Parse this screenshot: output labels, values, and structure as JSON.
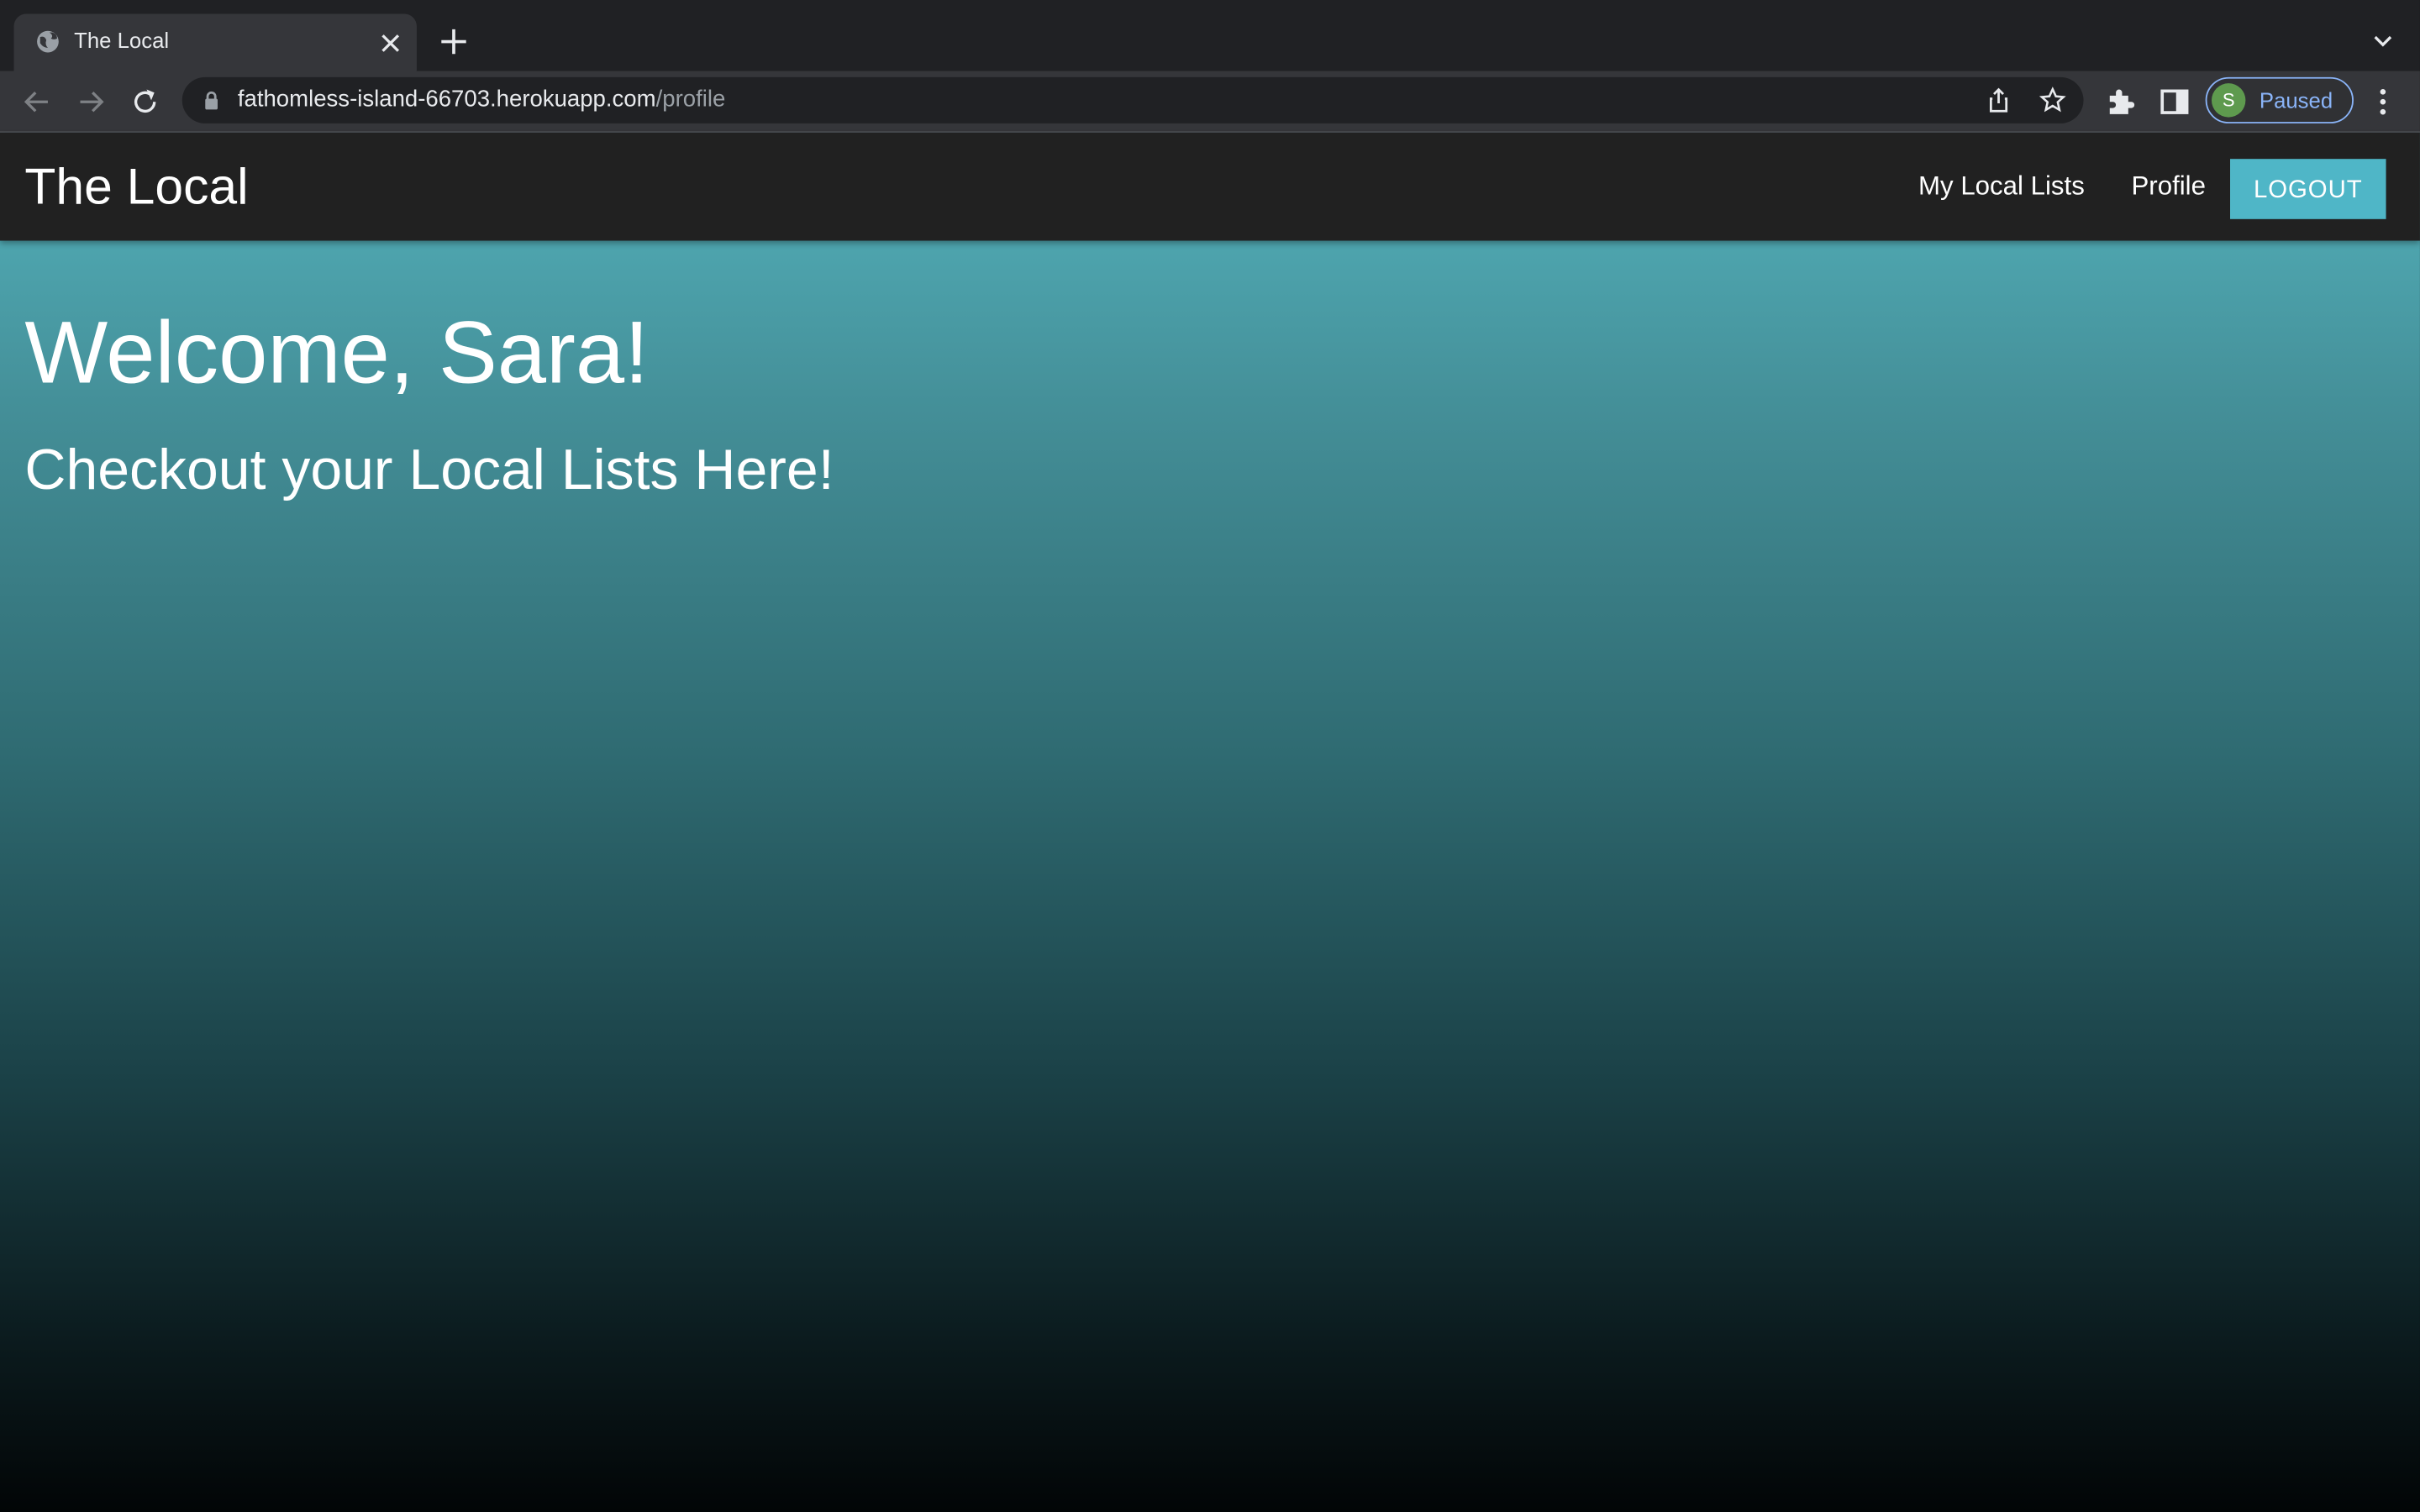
{
  "browser": {
    "tab": {
      "title": "The Local",
      "favicon": "globe-icon"
    },
    "address_bar": {
      "host": "fathomless-island-66703.herokuapp.com",
      "path": "/profile"
    },
    "profile": {
      "initial": "S",
      "status": "Paused"
    },
    "icons": {
      "back": "back-arrow-icon",
      "forward": "forward-arrow-icon",
      "reload": "reload-icon",
      "lock": "lock-icon",
      "share": "share-icon",
      "bookmark": "star-icon",
      "extensions": "puzzle-icon",
      "side_panel": "side-panel-icon",
      "menu": "kebab-menu-icon",
      "new_tab": "plus-icon",
      "tab_search": "chevron-down-icon",
      "close_tab": "close-icon"
    }
  },
  "navbar": {
    "brand": "The Local",
    "links": [
      {
        "label": "My Local Lists"
      },
      {
        "label": "Profile"
      }
    ],
    "logout_label": "LOGOUT"
  },
  "main": {
    "heading": "Welcome, Sara!",
    "subheading": "Checkout your Local Lists Here!"
  },
  "colors": {
    "accent": "#4fb6c7",
    "navbar_bg": "#212121",
    "gradient_top": "#54b2bc",
    "gradient_bottom": "#020506"
  }
}
